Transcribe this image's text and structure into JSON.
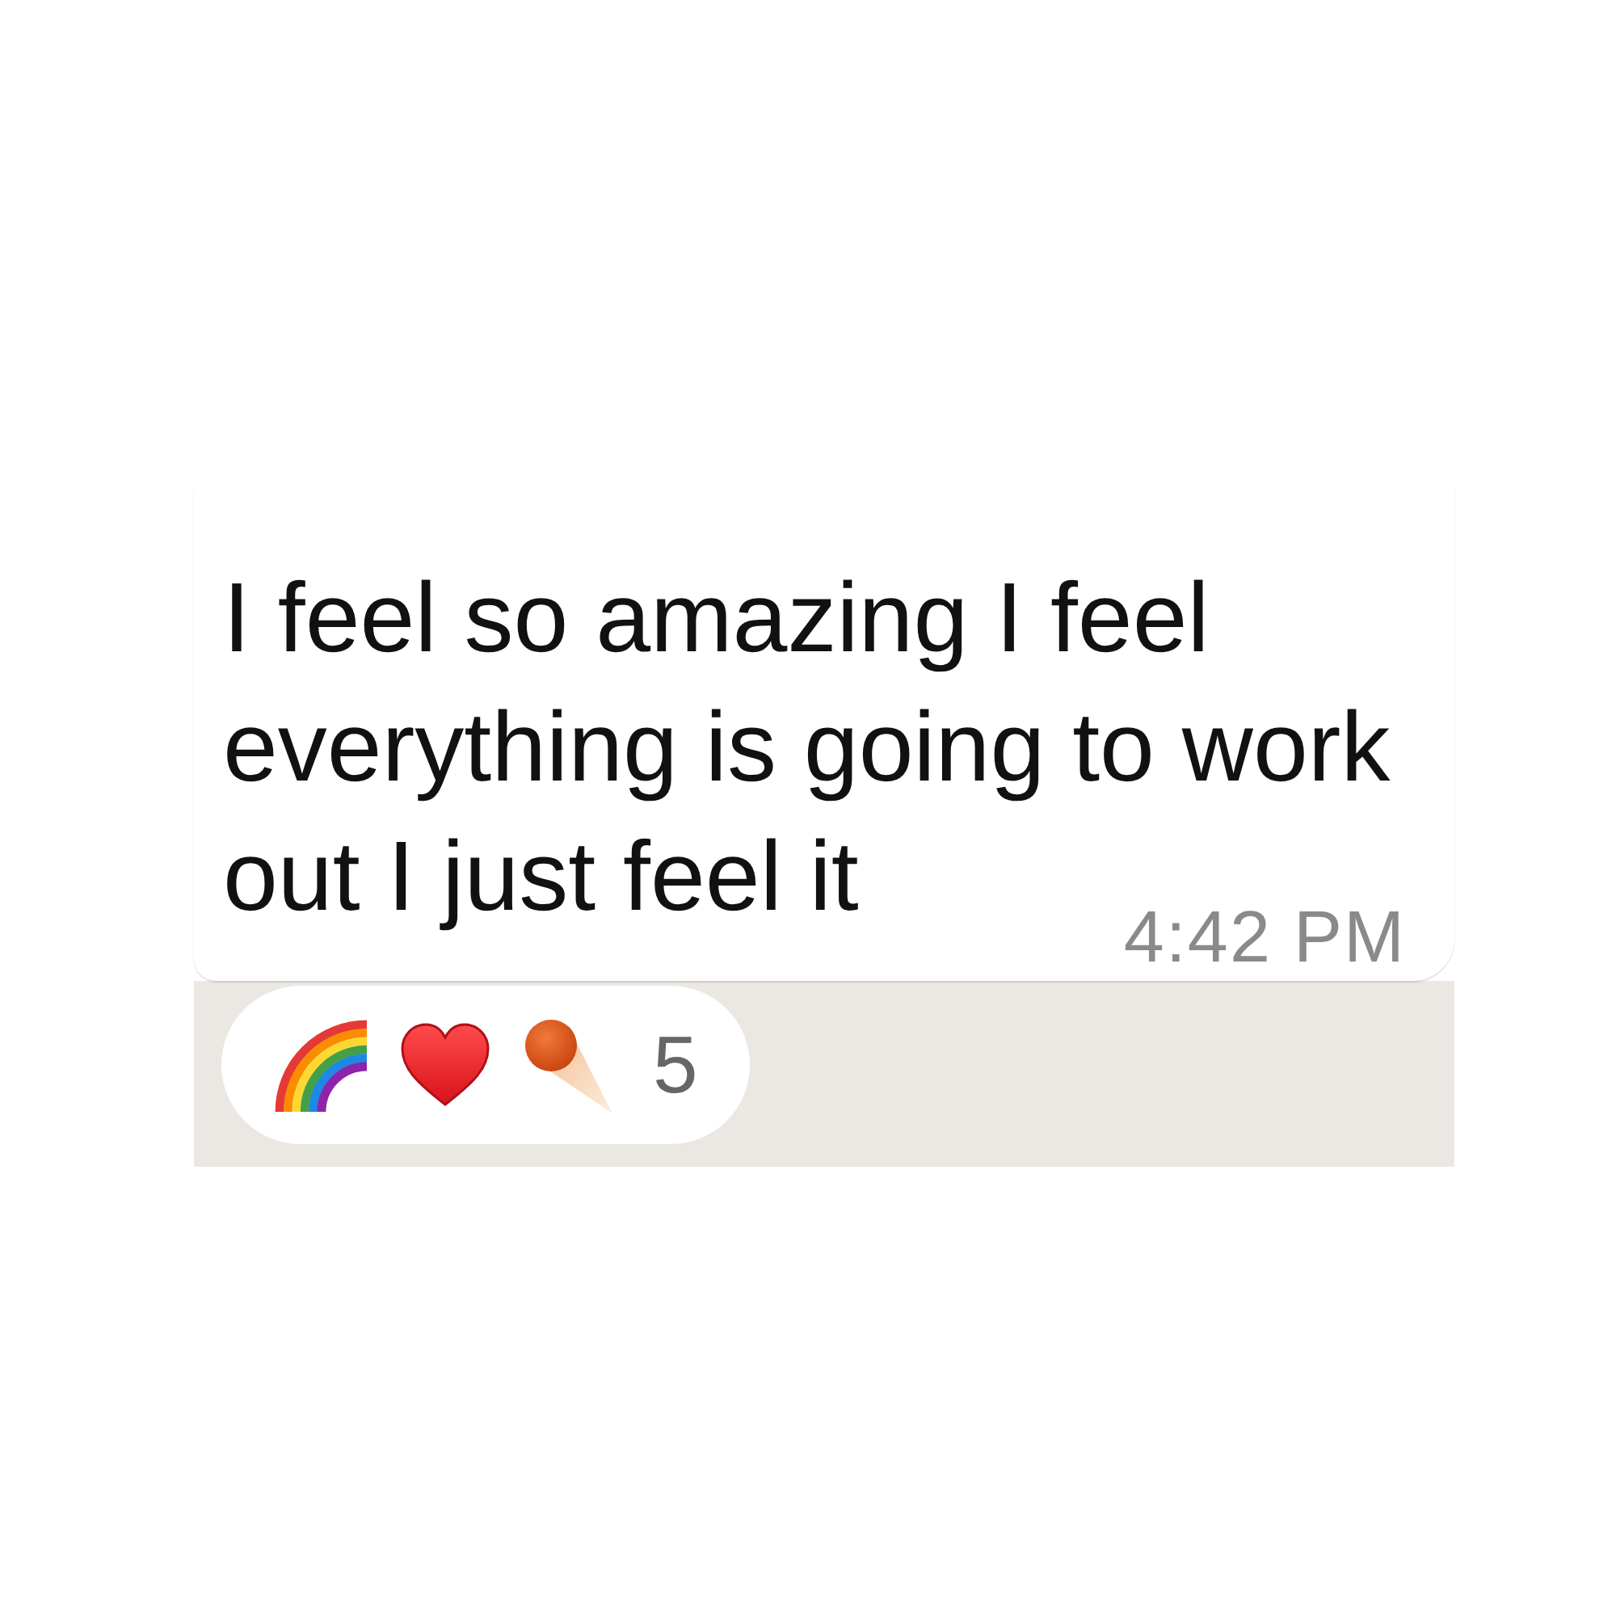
{
  "message": {
    "text": "I feel so amazing I feel everything is going to work out I just feel it",
    "time": "4:42 PM"
  },
  "reactions": {
    "emojis": [
      {
        "kind": "rainbow"
      },
      {
        "kind": "heart"
      },
      {
        "kind": "comet"
      }
    ],
    "count": "5"
  }
}
